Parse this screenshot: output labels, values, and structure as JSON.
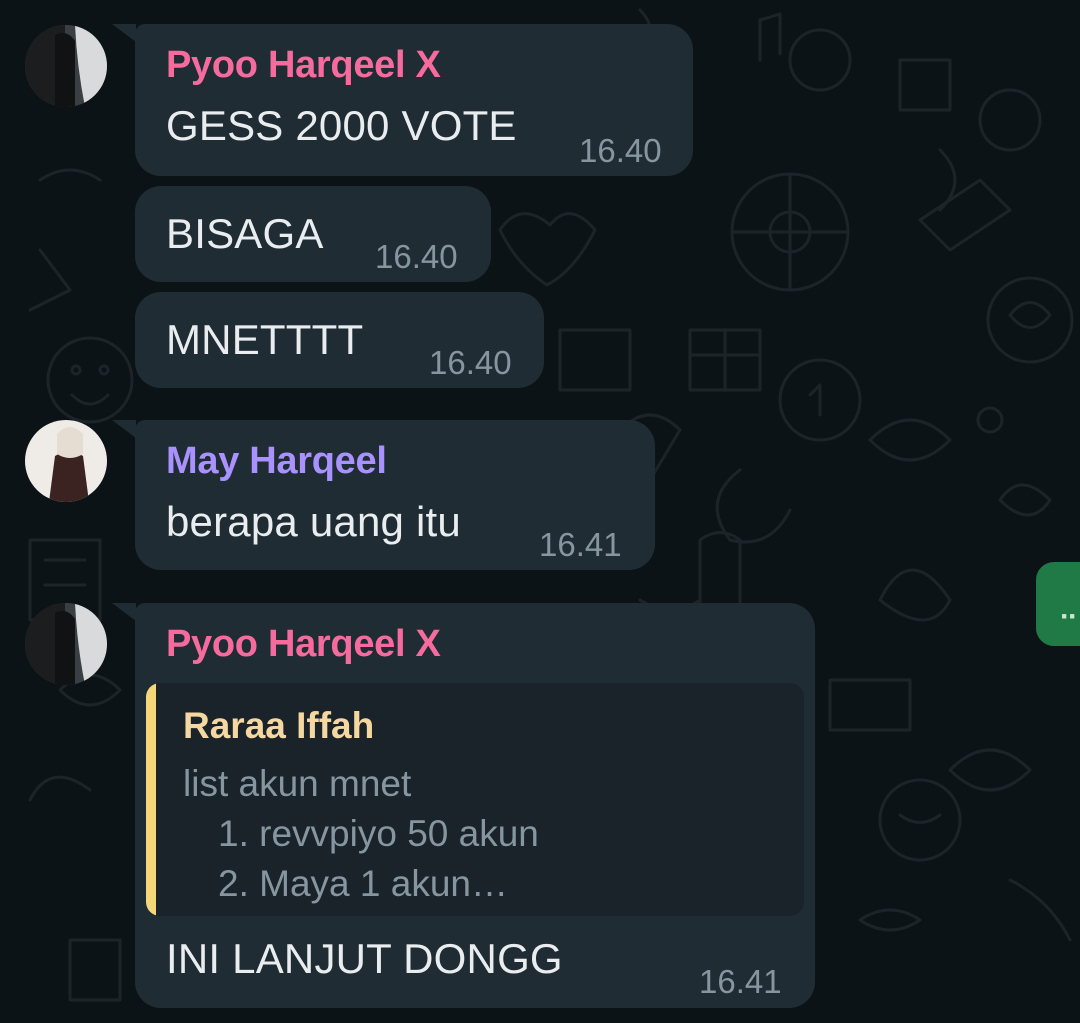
{
  "colors": {
    "chat_background": "#0c1317",
    "bubble_incoming": "#202c33",
    "sender_pyoo": "#f66b9d",
    "sender_may": "#a992ff",
    "quote_author": "#f5d7a1",
    "quote_bar": "#f5d77a",
    "timestamp": "#8696a0",
    "message_text": "#e9edef",
    "accent_green": "#1f7a45"
  },
  "messages": [
    {
      "sender": "Pyoo Harqeel X",
      "avatar": "avatar-pyoo",
      "text": "GESS 2000 VOTE",
      "time": "16.40"
    },
    {
      "text": "BISAGA",
      "time": "16.40"
    },
    {
      "text": "MNETTTT",
      "time": "16.40"
    },
    {
      "sender": "May Harqeel",
      "avatar": "avatar-may",
      "text": "berapa uang itu",
      "time": "16.41"
    },
    {
      "sender": "Pyoo Harqeel X",
      "avatar": "avatar-pyoo",
      "quote": {
        "author": "Raraa Iffah",
        "lines": [
          "list akun mnet",
          "1. revvpiyo 50 akun",
          "2. Maya 1 akun…"
        ]
      },
      "text": "INI LANJUT DONGG",
      "time": "16.41"
    }
  ],
  "floating_button": {
    "icon": "more-dots-icon",
    "label": "··"
  }
}
